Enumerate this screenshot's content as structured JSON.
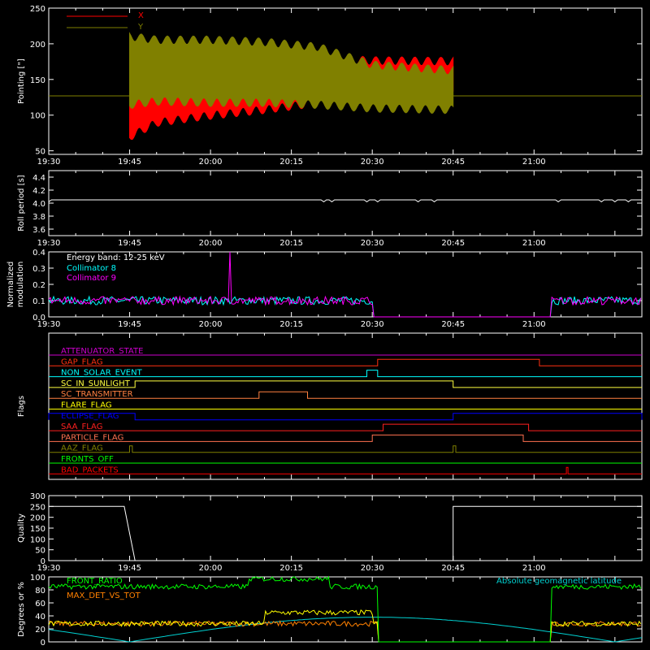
{
  "chart_data": [
    {
      "type": "line",
      "panel": "pointing",
      "ylabel": "Pointing [\"]",
      "ylim": [
        45,
        250
      ],
      "yticks": [
        "50",
        "100",
        "150",
        "200",
        "250"
      ],
      "xlim": [
        "19:30",
        "21:20"
      ],
      "xticks": [
        "19:30",
        "19:45",
        "20:00",
        "20:15",
        "20:30",
        "20:45",
        "21:00"
      ],
      "legend": "top-left",
      "series": [
        {
          "name": "X",
          "color": "#ff0000",
          "t_start": "19:45",
          "t_end": "20:45",
          "envelope_time": [
            "19:45",
            "19:50",
            "20:00",
            "20:10",
            "20:20",
            "20:30",
            "20:45"
          ],
          "upper": [
            185,
            190,
            188,
            182,
            178,
            176,
            175
          ],
          "lower": [
            70,
            90,
            100,
            108,
            118,
            125,
            130
          ]
        },
        {
          "name": "Y",
          "color": "#808000",
          "t_start": "19:45",
          "t_end": "20:45",
          "envelope_time": [
            "19:45",
            "19:50",
            "20:00",
            "20:10",
            "20:20",
            "20:30",
            "20:45"
          ],
          "upper": [
            210,
            205,
            205,
            202,
            195,
            170,
            162
          ],
          "lower": [
            115,
            120,
            118,
            118,
            115,
            110,
            108
          ]
        }
      ],
      "reference_line": {
        "value": 127,
        "color": "#808000"
      }
    },
    {
      "type": "line",
      "panel": "roll_period",
      "ylabel": "Roll period [s]",
      "ylim": [
        3.5,
        4.5
      ],
      "yticks": [
        "3.6",
        "3.8",
        "4.0",
        "4.2",
        "4.4"
      ],
      "series": [
        {
          "color": "#ffffff",
          "value": 4.05
        }
      ]
    },
    {
      "type": "line",
      "panel": "modulation",
      "ylabel": "Normalized modulation",
      "ylim": [
        0.0,
        0.4
      ],
      "yticks": [
        "0.0",
        "0.1",
        "0.2",
        "0.3",
        "0.4"
      ],
      "annotation": "Energy band: 12-25 keV",
      "series": [
        {
          "name": "Collimator 8",
          "color": "#00ffff",
          "level": 0.1
        },
        {
          "name": "Collimator 9",
          "color": "#ff00ff",
          "level": 0.1
        }
      ],
      "gap": [
        "20:30",
        "21:03"
      ]
    },
    {
      "type": "line",
      "panel": "flags",
      "ylabel": "Flags",
      "flags": [
        {
          "name": "ATTENUATOR_STATE",
          "color": "#cc00cc",
          "on": []
        },
        {
          "name": "GAP_FLAG",
          "color": "#ff3010",
          "on": [
            [
              "20:31",
              "21:01"
            ]
          ]
        },
        {
          "name": "NON_SOLAR_EVENT",
          "color": "#00ffff",
          "on": [
            [
              "20:29",
              "20:31"
            ]
          ]
        },
        {
          "name": "SC_IN_SUNLIGHT",
          "color": "#ffff40",
          "on": [
            [
              "19:46",
              "20:45"
            ]
          ]
        },
        {
          "name": "SC_TRANSMITTER",
          "color": "#ff8040",
          "on": [
            [
              "20:09",
              "20:18"
            ]
          ]
        },
        {
          "name": "FLARE_FLAG",
          "color": "#ffff00",
          "on": []
        },
        {
          "name": "ECLIPSE_FLAG",
          "color": "#0000ff",
          "on": [
            [
              "19:30",
              "19:46"
            ],
            [
              "20:45",
              "21:20"
            ]
          ]
        },
        {
          "name": "SAA_FLAG",
          "color": "#ff2020",
          "on": [
            [
              "20:32",
              "20:59"
            ]
          ]
        },
        {
          "name": "PARTICLE_FLAG",
          "color": "#ff7050",
          "on": [
            [
              "20:30",
              "20:58"
            ]
          ]
        },
        {
          "name": "AAZ_FLAG",
          "color": "#808000",
          "on": [
            [
              "19:45",
              "19:45.5"
            ],
            [
              "20:45",
              "20:45.5"
            ]
          ]
        },
        {
          "name": "FRONTS_OFF",
          "color": "#00ff00",
          "on": []
        },
        {
          "name": "BAD_PACKETS",
          "color": "#ff0000",
          "on": [
            [
              "21:06",
              "21:06.3"
            ]
          ]
        }
      ]
    },
    {
      "type": "line",
      "panel": "quality",
      "ylabel": "Quality",
      "ylim": [
        0,
        300
      ],
      "yticks": [
        "0",
        "50",
        "100",
        "150",
        "200",
        "250",
        "300"
      ],
      "series": [
        {
          "color": "#ffffff",
          "segments": [
            {
              "t": [
                "19:30",
                "19:44",
                "19:46"
              ],
              "v": [
                250,
                250,
                0
              ]
            },
            {
              "t": [
                "19:46",
                "20:45"
              ],
              "v": [
                0,
                0
              ]
            },
            {
              "t": [
                "20:45",
                "20:45",
                "21:20"
              ],
              "v": [
                0,
                250,
                250
              ]
            }
          ]
        }
      ]
    },
    {
      "type": "line",
      "panel": "misc",
      "ylabel": "Degrees or %",
      "ylim": [
        0,
        100
      ],
      "yticks": [
        "0",
        "20",
        "40",
        "60",
        "80",
        "100"
      ],
      "series": [
        {
          "name": "FRONT_RATIO",
          "color": "#00ff00",
          "level": 85
        },
        {
          "name": "MAX_DET_VS_TOT",
          "color": "#ff8000",
          "level": 30
        },
        {
          "name": "",
          "color": "#ffff00",
          "level": 30
        },
        {
          "name": "Absolute geomagnetic latitude",
          "color": "#00d0d0",
          "level": 20
        }
      ]
    }
  ],
  "colors": {
    "background": "#000000",
    "axes": "#ffffff"
  }
}
